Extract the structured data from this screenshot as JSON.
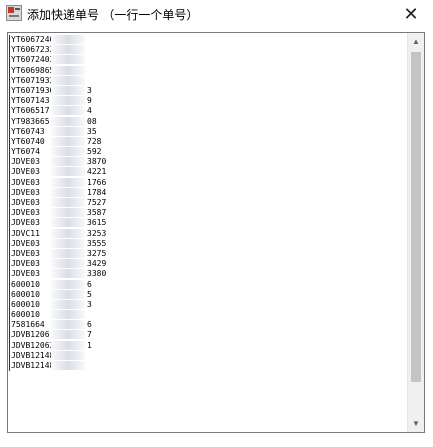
{
  "window": {
    "title": "添加快递单号 （一行一个单号）",
    "close_glyph": "✕"
  },
  "textarea": {
    "lines": [
      {
        "pre": "YT6067240",
        "suf": ""
      },
      {
        "pre": "YT6067233",
        "suf": ""
      },
      {
        "pre": "YT6072403",
        "suf": ""
      },
      {
        "pre": "YT6069865",
        "suf": ""
      },
      {
        "pre": "YT6071933",
        "suf": ""
      },
      {
        "pre": "YT6071936",
        "suf": "3"
      },
      {
        "pre": "YT607143",
        "suf": "9"
      },
      {
        "pre": "YT606517",
        "suf": "4"
      },
      {
        "pre": "YT983665",
        "suf": "08"
      },
      {
        "pre": "YT60743",
        "suf": "35"
      },
      {
        "pre": "YT60740",
        "suf": "728"
      },
      {
        "pre": "YT6074",
        "suf": "592"
      },
      {
        "pre": "JDVE03",
        "suf": "3870"
      },
      {
        "pre": "JDVE03",
        "suf": "4221"
      },
      {
        "pre": "JDVE03",
        "suf": "1766"
      },
      {
        "pre": "JDVE03",
        "suf": "1784"
      },
      {
        "pre": "JDVE03",
        "suf": "7527"
      },
      {
        "pre": "JDVE03",
        "suf": "3587"
      },
      {
        "pre": "JDVE03",
        "suf": "3615"
      },
      {
        "pre": "JDVC11",
        "suf": "3253"
      },
      {
        "pre": "JDVE03",
        "suf": "3555"
      },
      {
        "pre": "JDVE03",
        "suf": "3275"
      },
      {
        "pre": "JDVE03",
        "suf": "3429"
      },
      {
        "pre": "JDVE03",
        "suf": "3380"
      },
      {
        "pre": "600010",
        "suf": "6"
      },
      {
        "pre": "600010",
        "suf": "5"
      },
      {
        "pre": "600010",
        "suf": "3"
      },
      {
        "pre": "600010",
        "suf": ""
      },
      {
        "pre": "7581664",
        "suf": "6"
      },
      {
        "pre": "JDVB1206",
        "suf": "7"
      },
      {
        "pre": "JDVB12063",
        "suf": "1"
      },
      {
        "pre": "JDVB12148",
        "suf": ""
      },
      {
        "pre": "JDVB12148",
        "suf": ""
      }
    ]
  }
}
